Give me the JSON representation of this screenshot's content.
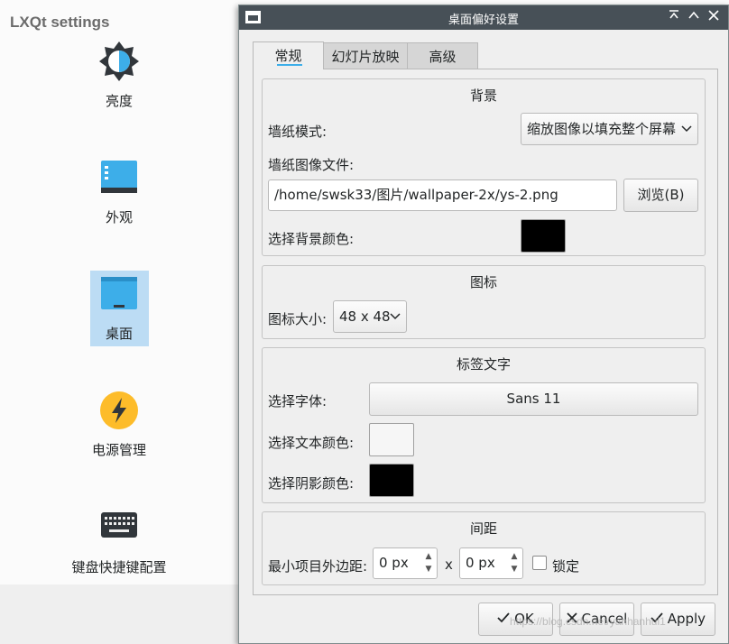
{
  "lxqt": {
    "title": "LXQt settings",
    "categories": [
      {
        "label": "亮度",
        "icon": "brightness-icon"
      },
      {
        "label": "外观",
        "icon": "appearance-icon"
      },
      {
        "label": "桌面",
        "icon": "desktop-icon",
        "selected": true
      },
      {
        "label": "电源管理",
        "icon": "power-management-icon"
      },
      {
        "label": "键盘快捷键配置",
        "icon": "keyboard-icon"
      }
    ]
  },
  "dialog": {
    "title": "桌面偏好设置",
    "tabs": [
      "常规",
      "幻灯片放映",
      "高级"
    ],
    "background": {
      "title": "背景",
      "wallpaper_mode_label": "墙纸模式:",
      "wallpaper_mode_value": "缩放图像以填充整个屏幕",
      "wallpaper_file_label": "墙纸图像文件:",
      "wallpaper_file_value": "/home/swsk33/图片/wallpaper-2x/ys-2.png",
      "browse_label": "浏览(B)",
      "bg_color_label": "选择背景颜色:",
      "bg_color": "#000000"
    },
    "icons": {
      "title": "图标",
      "size_label": "图标大小:",
      "size_value": "48 x 48"
    },
    "label_text": {
      "title": "标签文字",
      "font_label": "选择字体:",
      "font_value": "Sans 11",
      "text_color_label": "选择文本颜色:",
      "text_color": "#f6f6f6",
      "shadow_color_label": "选择阴影颜色:",
      "shadow_color": "#000000"
    },
    "spacing": {
      "title": "间距",
      "margin_label": "最小项目外边距:",
      "margin_x": "0 px",
      "x_sep": "x",
      "margin_y": "0 px",
      "lock_label": "锁定"
    },
    "buttons": {
      "ok": "OK",
      "cancel": "Cancel",
      "apply": "Apply"
    },
    "watermark": "https://blog.csdn.net/yanhanhui1"
  }
}
